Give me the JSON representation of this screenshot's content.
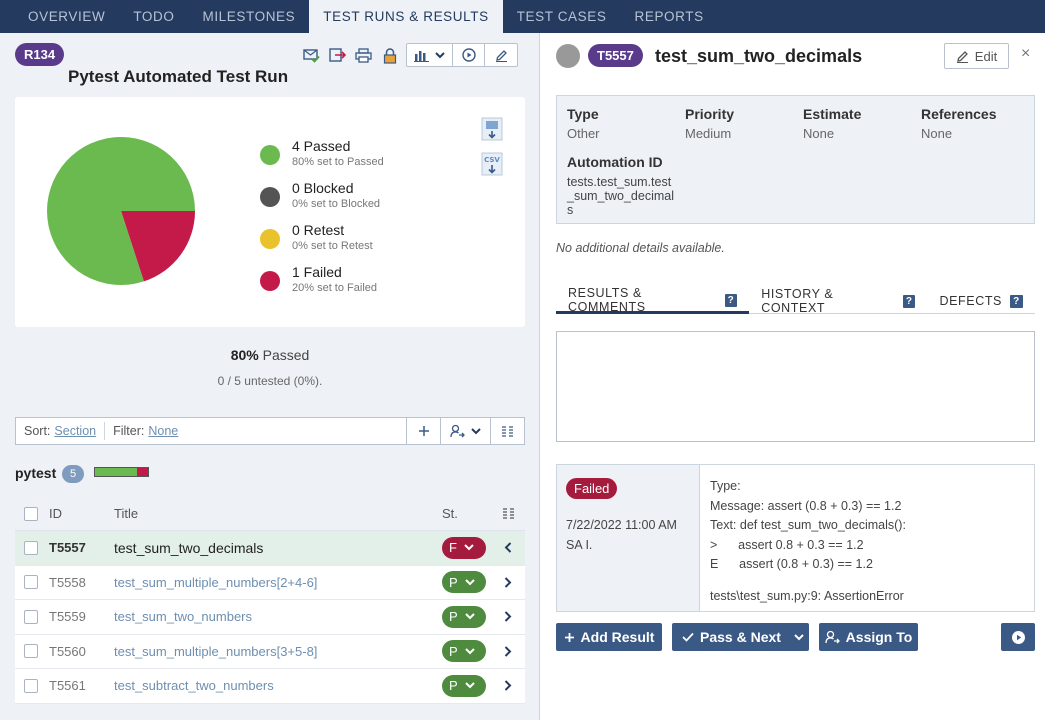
{
  "nav": {
    "tabs": [
      {
        "label": "OVERVIEW"
      },
      {
        "label": "TODO"
      },
      {
        "label": "MILESTONES"
      },
      {
        "label": "TEST RUNS & RESULTS"
      },
      {
        "label": "TEST CASES"
      },
      {
        "label": "REPORTS"
      }
    ],
    "active": "TEST RUNS & RESULTS"
  },
  "run": {
    "id": "R134",
    "title": "Pytest Automated Test Run"
  },
  "chart_data": {
    "type": "pie",
    "categories": [
      "Passed",
      "Blocked",
      "Retest",
      "Failed"
    ],
    "values": [
      4,
      0,
      0,
      1
    ],
    "colors": [
      "#6bba4f",
      "#545454",
      "#eac32c",
      "#c41a4a"
    ]
  },
  "legend": [
    {
      "label": "4 Passed",
      "sub": "80% set to Passed",
      "color": "#6bba4f"
    },
    {
      "label": "0 Blocked",
      "sub": "0% set to Blocked",
      "color": "#545454"
    },
    {
      "label": "0 Retest",
      "sub": "0% set to Retest",
      "color": "#eac32c"
    },
    {
      "label": "1 Failed",
      "sub": "20% set to Failed",
      "color": "#c41a4a"
    }
  ],
  "summary": {
    "pct": "80%",
    "pct_label": "Passed",
    "untested": "0 / 5 untested (0%)."
  },
  "sortbar": {
    "sort_label": "Sort:",
    "sort_value": "Section",
    "filter_label": "Filter:",
    "filter_value": "None"
  },
  "section": {
    "name": "pytest",
    "count": "5",
    "passed_fraction": 0.8,
    "failed_fraction": 0.2
  },
  "table": {
    "headers": {
      "id": "ID",
      "title": "Title",
      "status": "St."
    },
    "rows": [
      {
        "id": "T5557",
        "title": "test_sum_two_decimals",
        "status": "F"
      },
      {
        "id": "T5558",
        "title": "test_sum_multiple_numbers[2+4-6]",
        "status": "P"
      },
      {
        "id": "T5559",
        "title": "test_sum_two_numbers",
        "status": "P"
      },
      {
        "id": "T5560",
        "title": "test_sum_multiple_numbers[3+5-8]",
        "status": "P"
      },
      {
        "id": "T5561",
        "title": "test_subtract_two_numbers",
        "status": "P"
      }
    ]
  },
  "detail": {
    "id": "T5557",
    "title": "test_sum_two_decimals",
    "edit_label": "Edit",
    "close": "×",
    "fields": {
      "type_label": "Type",
      "type_value": "Other",
      "priority_label": "Priority",
      "priority_value": "Medium",
      "estimate_label": "Estimate",
      "estimate_value": "None",
      "references_label": "References",
      "references_value": "None",
      "automation_label": "Automation ID",
      "automation_value": "tests.test_sum.test_sum_two_decimals"
    },
    "no_details": "No additional details available.",
    "tabs": [
      {
        "label": "RESULTS & COMMENTS"
      },
      {
        "label": "HISTORY & CONTEXT"
      },
      {
        "label": "DEFECTS"
      }
    ],
    "help_glyph": "?",
    "result": {
      "status": "Failed",
      "date": "7/22/2022 11:00 AM",
      "user": "SA I.",
      "lines": [
        "Type:",
        "Message: assert (0.8 + 0.3) == 1.2",
        "Text: def test_sum_two_decimals():",
        ">      assert 0.8 + 0.3 == 1.2",
        "E      assert (0.8 + 0.3) == 1.2",
        "",
        "tests\\test_sum.py:9: AssertionError"
      ]
    },
    "actions": {
      "add_result": "Add Result",
      "pass_next": "Pass & Next",
      "assign_to": "Assign To"
    }
  }
}
